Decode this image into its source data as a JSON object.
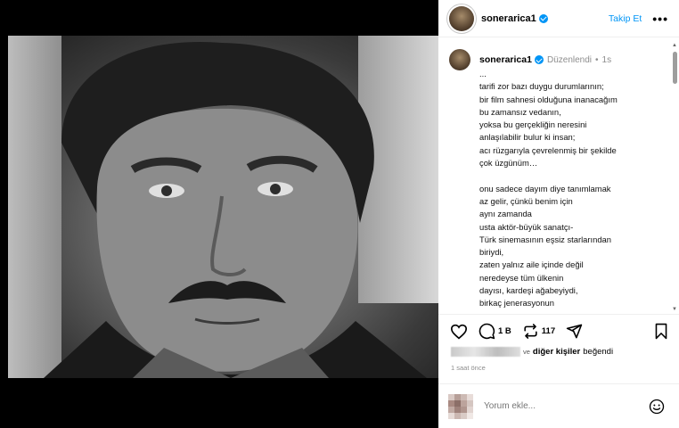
{
  "post": {
    "username": "soneraricа1",
    "follow_label": "Takip Et",
    "more_label": "•••"
  },
  "caption": {
    "username": "soneraricа1",
    "edited_label": "Düzenlendi",
    "time": "1s",
    "lines": [
      "...",
      "tarifi zor bazı duygu durumlarının;",
      "bir film sahnesi olduğuna inanacağım",
      "bu zamansız vedanın,",
      "yoksa bu gerçekliğin neresini",
      "anlaşılabilir bulur ki insan;",
      "acı rüzgarıyla çevrelenmiş bir şekilde",
      "çok üzgünüm…",
      "",
      "onu sadece dayım diye tanımlamak",
      "az gelir, çünkü benim için",
      "aynı zamanda",
      "usta aktör-büyük sanatçı-",
      "Türk sinemasının eşsiz starlarından",
      "biriydi,",
      "zaten yalnız aile içinde değil",
      "neredeyse tüm ülkenin",
      "dayısı, kardeşi ağabeyiydi,",
      "birkaç jenerasyonun"
    ]
  },
  "actions": {
    "comments_count": "1 B",
    "reposts_count": "117"
  },
  "likes": {
    "connector": "ve",
    "others_label": "diğer kişiler",
    "liked_label": "beğendi"
  },
  "time_ago": "1 saat önce",
  "comment": {
    "placeholder": "Yorum ekle..."
  },
  "colors": {
    "accent": "#0095f6",
    "muted": "#8e8e8e"
  },
  "icons": [
    "heart-icon",
    "comment-icon",
    "repost-icon",
    "share-icon",
    "bookmark-icon",
    "verified-icon",
    "emoji-icon",
    "more-icon"
  ]
}
